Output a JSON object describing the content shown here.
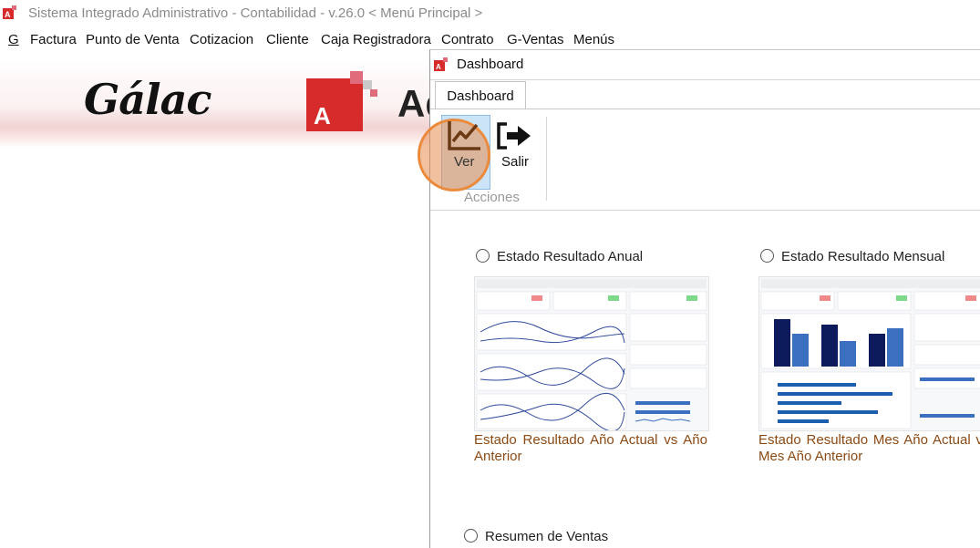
{
  "window": {
    "title": "Sistema Integrado Administrativo - Contabilidad - v.26.0 < Menú Principal >"
  },
  "menu": {
    "items": [
      {
        "label": "G"
      },
      {
        "label": "Factura"
      },
      {
        "label": "Punto de Venta"
      },
      {
        "label": "Cotizacion"
      },
      {
        "label": "Cliente"
      },
      {
        "label": "Caja Registradora"
      },
      {
        "label": "Contrato"
      },
      {
        "label": "G-Ventas"
      },
      {
        "label": "Menús"
      }
    ]
  },
  "banner": {
    "brand": "Gálac",
    "product_partial": "Ad"
  },
  "dashboard": {
    "title": "Dashboard",
    "tab": "Dashboard",
    "ribbon": {
      "ver": "Ver",
      "salir": "Salir",
      "group": "Acciones"
    },
    "options": [
      {
        "label": "Estado Resultado Anual",
        "caption_line1": "Estado Resultado Año Actual vs Año",
        "caption_line2": "Anterior"
      },
      {
        "label": "Estado Resultado Mensual",
        "caption_line1": "Estado Resultado Mes Año Actual v",
        "caption_line2": "Mes Año Anterior"
      },
      {
        "label": "Resumen de Ventas"
      }
    ]
  },
  "colors": {
    "caption": "#8b4a14",
    "highlight": "#ec8a3c",
    "brand_red": "#d72b2b"
  }
}
